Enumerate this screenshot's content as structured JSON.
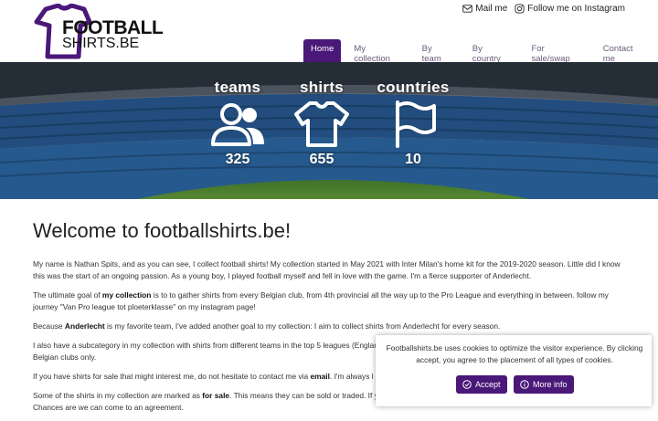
{
  "logo": {
    "line1": "FOOTBALL",
    "line2": "SHIRTS.BE",
    "brand_color": "#4a1878"
  },
  "toplinks": [
    {
      "label": "Mail me",
      "icon": "mail-icon"
    },
    {
      "label": "Follow me on Instagram",
      "icon": "instagram-icon"
    }
  ],
  "nav": {
    "items": [
      {
        "label": "Home",
        "active": true
      },
      {
        "label": "My collection"
      },
      {
        "label": "By team"
      },
      {
        "label": "By country"
      },
      {
        "label": "For sale/swap"
      },
      {
        "label": "Contact me"
      }
    ]
  },
  "stats": [
    {
      "label": "teams",
      "value": "325",
      "icon": "users-icon"
    },
    {
      "label": "shirts",
      "value": "655",
      "icon": "shirt-icon"
    },
    {
      "label": "countries",
      "value": "10",
      "icon": "flag-icon"
    }
  ],
  "content": {
    "title": "Welcome to footballshirts.be!",
    "p1": "My name is Nathan Spits, and as you can see, I collect football shirts! My collection started in May 2021 with Inter Milan's home kit for the 2019-2020 season. Little did I know this was the start of an ongoing passion. As a young boy, I played football myself and fell in love with the game. I'm a fierce supporter of Anderlecht.",
    "p2_a": "The ultimate goal of ",
    "p2_b": "my collection",
    "p2_c": " is to to gather shirts from every Belgian club, from 4th provincial all the way up to the Pro League and everything in between. follow my journey \"Van Pro league tot ploeterklasse\" on my instagram page!",
    "p3_a": "Because ",
    "p3_b": "Anderlecht",
    "p3_c": " is my favorite team, I've added another goal to my collection: I aim to collect shirts from Anderlecht for every season.",
    "p4": "I also have a subcategory in my collection with shirts from different teams in the top 5 leagues (Englan",
    "p4_b": "Belgian clubs only.",
    "p5_a": "If you have shirts for sale that might interest me, do not hesitate to contact me via ",
    "p5_b": "email",
    "p5_c": ". I'm always l",
    "p6_a": "Some of the shirts in my collection are marked as ",
    "p6_b": "for sale",
    "p6_c": ". This means they can be sold or traded. If y",
    "p6_d": "Chances are we can come to an agreement."
  },
  "cookie": {
    "text": "Footballshirts.be uses cookies to optimize the visitor experience. By clicking accept, you agree to the placement of all types of cookies.",
    "accept_label": "Accept",
    "more_label": "More info"
  }
}
